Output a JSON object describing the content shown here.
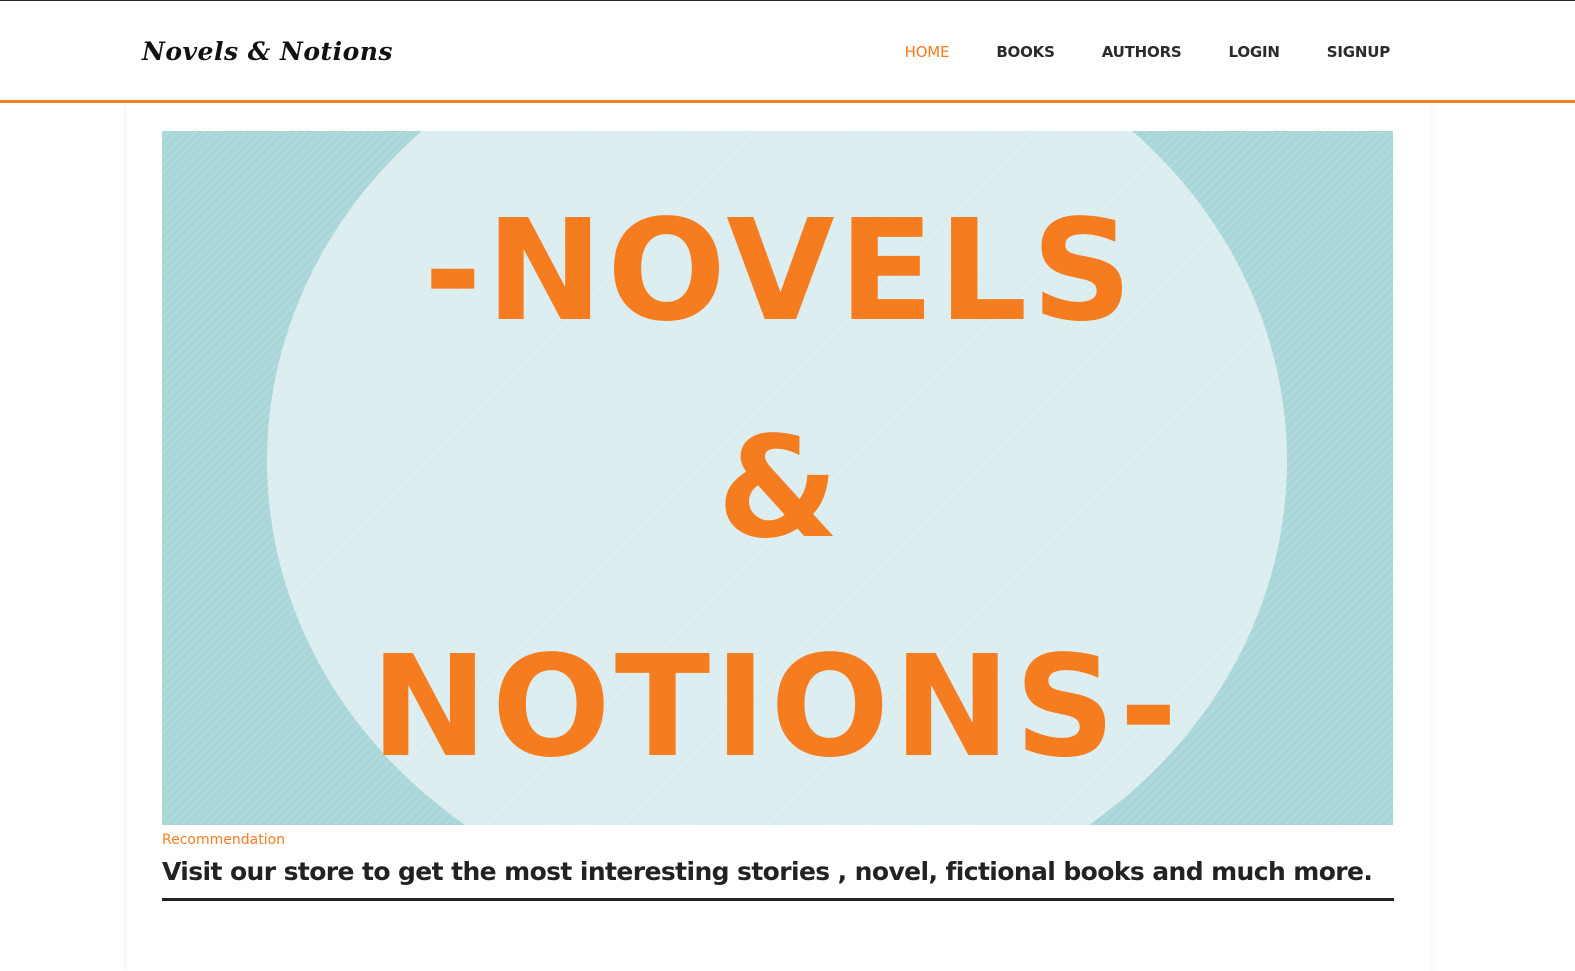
{
  "header": {
    "logo_text": "Novels & Notions",
    "nav": [
      {
        "label": "HOME",
        "active": true
      },
      {
        "label": "BOOKS",
        "active": false
      },
      {
        "label": "AUTHORS",
        "active": false
      },
      {
        "label": "LOGIN",
        "active": false
      },
      {
        "label": "SIGNUP",
        "active": false
      }
    ]
  },
  "featured": {
    "image": {
      "line1": "-NOVELS",
      "line2": "&",
      "line3": "NOTIONS-"
    },
    "category": "Recommendation",
    "headline": "Visit our store to get the most interesting stories , novel, fictional books and much more."
  },
  "colors": {
    "accent": "#f57c1f",
    "text_dark": "#222222",
    "hero_bg": "#a9d6d8",
    "hero_circle": "#dcedf0"
  }
}
